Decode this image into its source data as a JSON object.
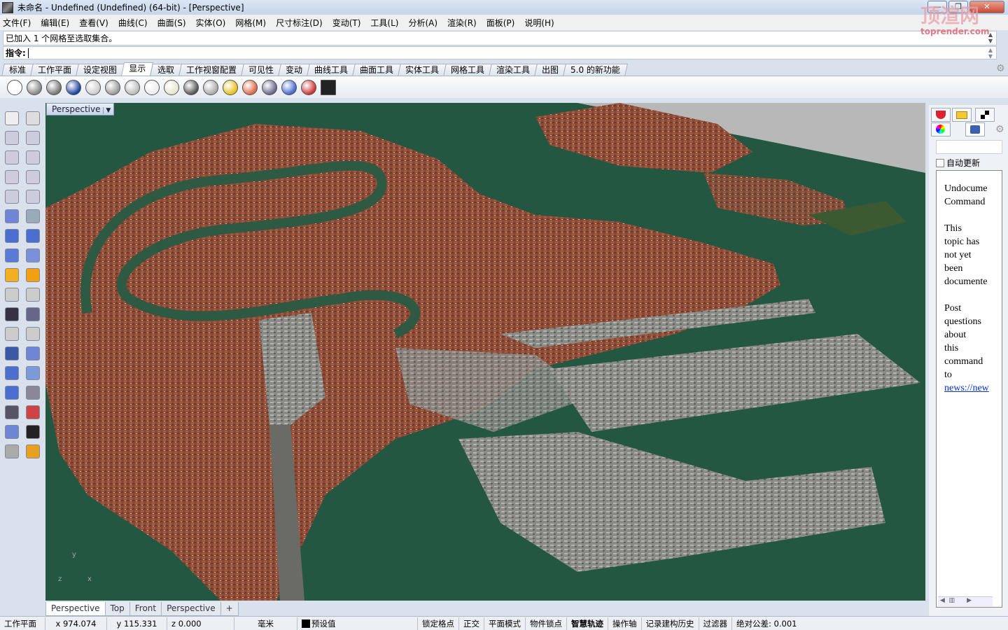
{
  "title_bar": {
    "title": "未命名 - Undefined (Undefined) (64-bit) - [Perspective]",
    "minimize": "—",
    "restore": "❐",
    "close": "✕"
  },
  "watermark": {
    "line1": "顶渲网",
    "line2": "toprender.com"
  },
  "menu": [
    "文件(F)",
    "编辑(E)",
    "查看(V)",
    "曲线(C)",
    "曲面(S)",
    "实体(O)",
    "网格(M)",
    "尺寸标注(D)",
    "变动(T)",
    "工具(L)",
    "分析(A)",
    "渲染(R)",
    "面板(P)",
    "说明(H)"
  ],
  "command": {
    "history": "已加入 1 个网格至选取集合。",
    "prompt": "指令:",
    "value": ""
  },
  "toolbar_tabs": {
    "items": [
      "标准",
      "工作平面",
      "设定视图",
      "显示",
      "选取",
      "工作视窗配置",
      "可见性",
      "变动",
      "曲线工具",
      "曲面工具",
      "实体工具",
      "网格工具",
      "渲染工具",
      "出图",
      "5.0 的新功能"
    ],
    "active": "显示"
  },
  "display_icons": [
    "wireframe",
    "shaded",
    "rendered",
    "ghosted",
    "x-ray",
    "technical",
    "pen",
    "artistic",
    "arctic",
    "render-mesh-settings",
    "shaded-sphere",
    "rendered-sphere",
    "section",
    "camera",
    "clipping-plane",
    "disable-clipping",
    "monitor"
  ],
  "left_toolbar_icons": [
    "select-arrow",
    "point",
    "polyline",
    "curve-control-points",
    "circle",
    "ellipse",
    "polygon",
    "rectangle",
    "hexagon",
    "fillet-curve",
    "surface-points",
    "extrude-surface",
    "box",
    "sphere",
    "cylinder",
    "mesh-surface",
    "boolean",
    "explode",
    "split",
    "trim",
    "join",
    "group-objects",
    "offset-curve",
    "blend-curve",
    "text",
    "scale",
    "array-grid",
    "align",
    "solid-box",
    "extrude-plane",
    "grid-array",
    "dimension",
    "rotate",
    "check",
    "shapes",
    "render-prism"
  ],
  "viewport": {
    "title": "Perspective",
    "axis": {
      "x": "x",
      "y": "y",
      "z": "z"
    },
    "colors": {
      "water": "#245742",
      "land": "#8a4a36",
      "sky": "#b8b8b8"
    }
  },
  "viewport_tabs": {
    "items": [
      "Perspective",
      "Top",
      "Front",
      "Perspective"
    ],
    "add": "+",
    "active": "Perspective"
  },
  "right_panel": {
    "auto_update": "自动更新",
    "auto_update_checked": false,
    "search": "",
    "help_paragraphs": [
      [
        "Undocume",
        "Command"
      ],
      [
        "This",
        "topic has",
        "not yet",
        "been",
        "documente"
      ],
      [
        "Post",
        "questions",
        "about",
        "this",
        "command",
        "to",
        "news://new"
      ]
    ]
  },
  "status_bar": {
    "cplane": "工作平面",
    "x": "x 974.074",
    "y": "y 115.331",
    "z": "z 0.000",
    "units": "毫米",
    "layer": "预设值",
    "toggles": [
      "锁定格点",
      "正交",
      "平面模式",
      "物件锁点",
      "智慧轨迹",
      "操作轴",
      "记录建构历史",
      "过滤器"
    ],
    "tolerance": "绝对公差: 0.001"
  }
}
